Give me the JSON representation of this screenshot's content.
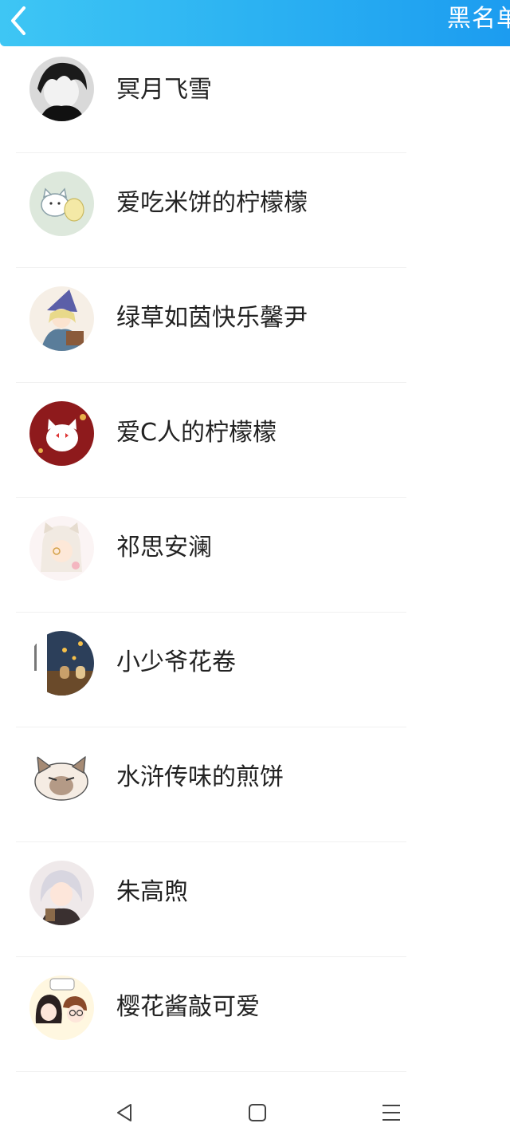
{
  "header": {
    "title": "黑名单",
    "back_icon": "chevron-left-icon"
  },
  "contacts": [
    {
      "name": "冥月飞雪",
      "avatar": "avatar-dark-hair"
    },
    {
      "name": "爱吃米饼的柠檬檬",
      "avatar": "avatar-cat-sketch"
    },
    {
      "name": "绿草如茵快乐馨尹",
      "avatar": "avatar-witch"
    },
    {
      "name": "爱C人的柠檬檬",
      "avatar": "avatar-red-cat"
    },
    {
      "name": "祁思安澜",
      "avatar": "avatar-cat-hood"
    },
    {
      "name": "小少爷花卷",
      "avatar": "avatar-autumn"
    },
    {
      "name": "水浒传味的煎饼",
      "avatar": "avatar-siamese-cat"
    },
    {
      "name": "朱高煦",
      "avatar": "avatar-silver-hair"
    },
    {
      "name": "樱花酱敲可爱",
      "avatar": "avatar-couple"
    }
  ],
  "navbar": {
    "back_icon": "triangle-back-icon",
    "home_icon": "square-home-icon",
    "menu_icon": "menu-lines-icon"
  },
  "colors": {
    "header_start": "#3ec6f4",
    "header_end": "#1c9cf0",
    "text": "#222222"
  }
}
